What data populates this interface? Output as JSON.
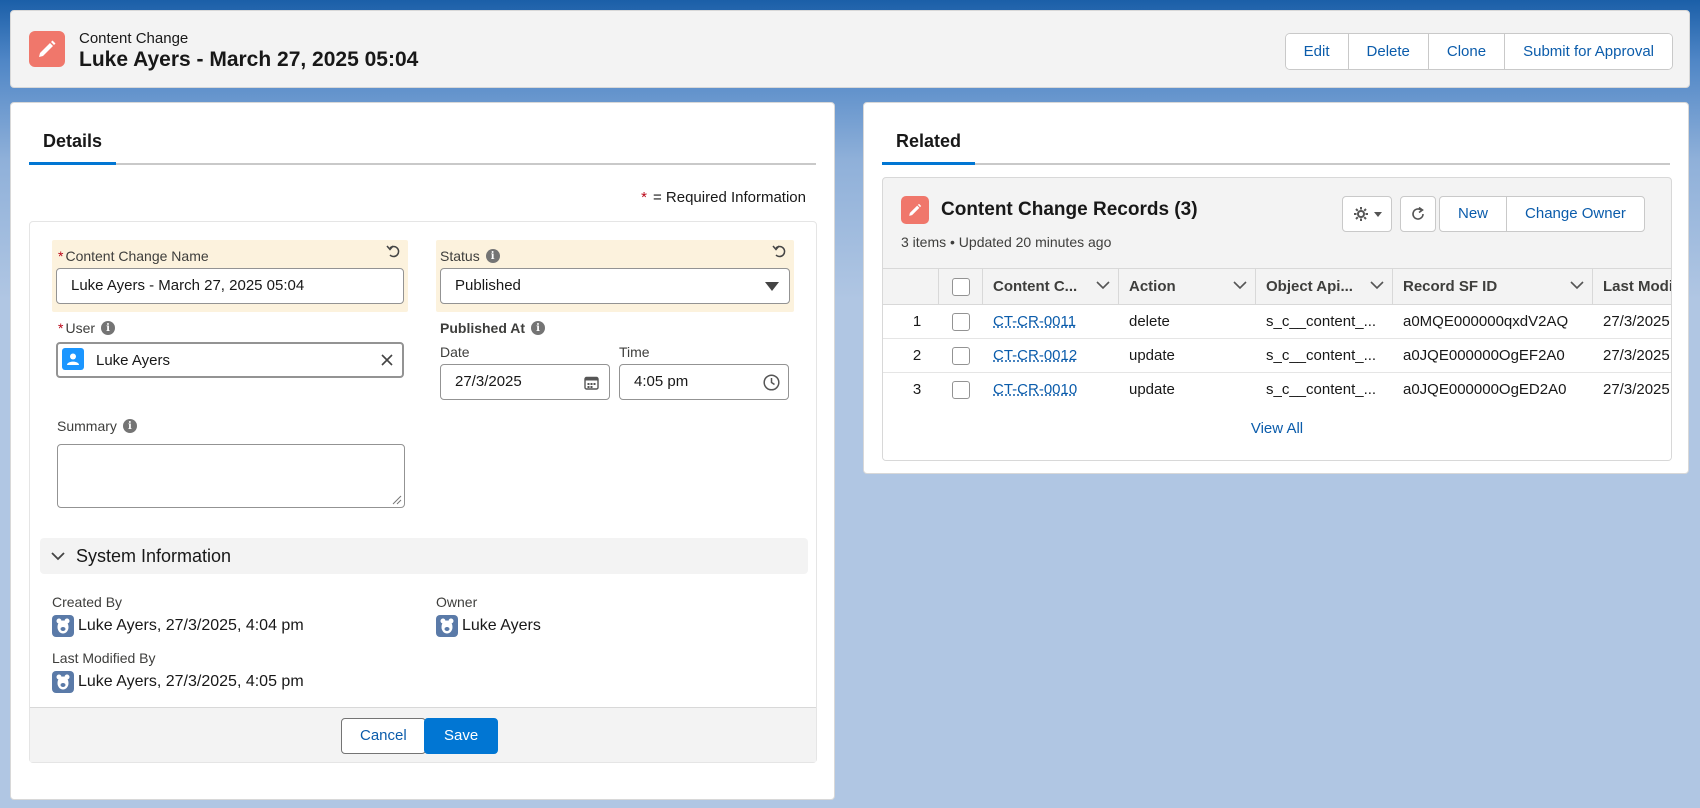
{
  "header": {
    "object_label": "Content Change",
    "title": "Luke Ayers - March 27, 2025 05:04",
    "actions": [
      "Edit",
      "Delete",
      "Clone",
      "Submit for Approval"
    ],
    "icon": "pencil-icon"
  },
  "details": {
    "tab_label": "Details",
    "required_star": "*",
    "required_text": "= Required Information",
    "fields": {
      "name_label": "Content Change Name",
      "name_value": "Luke Ayers - March 27, 2025 05:04",
      "status_label": "Status",
      "status_value": "Published",
      "user_label": "User",
      "user_value": "Luke Ayers",
      "published_at_label": "Published At",
      "date_label": "Date",
      "date_value": "27/3/2025",
      "time_label": "Time",
      "time_value": "4:05 pm",
      "summary_label": "Summary",
      "summary_value": ""
    },
    "system": {
      "section_title": "System Information",
      "created_by_label": "Created By",
      "created_by_value": "Luke Ayers, 27/3/2025, 4:04 pm",
      "owner_label": "Owner",
      "owner_value": "Luke Ayers",
      "last_modified_label": "Last Modified By",
      "last_modified_value": "Luke Ayers, 27/3/2025, 4:05 pm"
    },
    "footer": {
      "cancel": "Cancel",
      "save": "Save"
    }
  },
  "related": {
    "tab_label": "Related",
    "list": {
      "title": "Content Change Records (3)",
      "subtitle": "3 items • Updated 20 minutes ago",
      "buttons": [
        "New",
        "Change Owner"
      ],
      "view_all": "View All",
      "columns": [
        "Content C...",
        "Action",
        "Object Api...",
        "Record SF ID",
        "Last Modi"
      ],
      "rows": [
        {
          "num": "1",
          "name": "CT-CR-0011",
          "action": "delete",
          "object": "s_c__content_...",
          "record_id": "a0MQE000000qxdV2AQ",
          "last": "27/3/2025"
        },
        {
          "num": "2",
          "name": "CT-CR-0012",
          "action": "update",
          "object": "s_c__content_...",
          "record_id": "a0JQE000000OgEF2A0",
          "last": "27/3/2025"
        },
        {
          "num": "3",
          "name": "CT-CR-0010",
          "action": "update",
          "object": "s_c__content_...",
          "record_id": "a0JQE000000OgED2A0",
          "last": "27/3/2025"
        }
      ]
    }
  },
  "colors": {
    "brand": "#0176d3",
    "link": "#0b5cab",
    "object_icon": "#f0776b",
    "changed_field": "#fcf2dd"
  }
}
